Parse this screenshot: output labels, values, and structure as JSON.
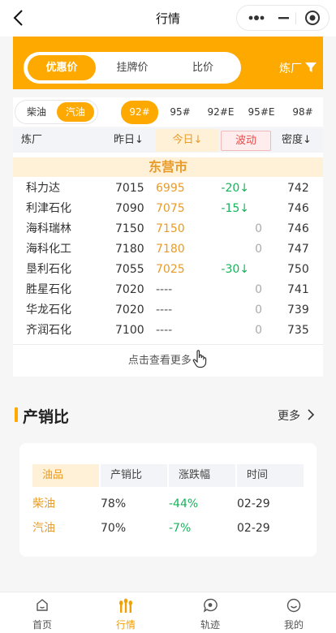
{
  "nav": {
    "title": "行情"
  },
  "header": {
    "tabs": [
      "优惠价",
      "挂牌价",
      "比价"
    ],
    "active_tab": 0,
    "refinery_filter": "炼厂"
  },
  "fuel": {
    "types": [
      "柴油",
      "汽油"
    ],
    "active": 1
  },
  "grades": {
    "items": [
      "92#",
      "95#",
      "92#E",
      "95#E",
      "98#"
    ],
    "active": 0
  },
  "table": {
    "headers": {
      "refinery": "炼厂",
      "yesterday": "昨日",
      "today": "今日",
      "wave": "波动",
      "density": "密度"
    },
    "region": "东营市",
    "rows": [
      {
        "name": "科力达",
        "yesterday": "7015",
        "today": "6995",
        "wave": "-20",
        "density": "742"
      },
      {
        "name": "利津石化",
        "yesterday": "7090",
        "today": "7075",
        "wave": "-15",
        "density": "746"
      },
      {
        "name": "海科瑞林",
        "yesterday": "7150",
        "today": "7150",
        "wave": "0",
        "density": "746"
      },
      {
        "name": "海科化工",
        "yesterday": "7180",
        "today": "7180",
        "wave": "0",
        "density": "747"
      },
      {
        "name": "垦利石化",
        "yesterday": "7055",
        "today": "7025",
        "wave": "-30",
        "density": "750"
      },
      {
        "name": "胜星石化",
        "yesterday": "7020",
        "today": "----",
        "wave": "0",
        "density": "741"
      },
      {
        "name": "华龙石化",
        "yesterday": "7020",
        "today": "----",
        "wave": "0",
        "density": "739"
      },
      {
        "name": "齐润石化",
        "yesterday": "7100",
        "today": "----",
        "wave": "0",
        "density": "735"
      }
    ],
    "more_label": "点击查看更多"
  },
  "ratio_section": {
    "title": "产销比",
    "more": "更多",
    "headers": [
      "油品",
      "产销比",
      "涨跌幅",
      "时间"
    ],
    "rows": [
      {
        "product": "柴油",
        "ratio": "78%",
        "change": "-44%",
        "time": "02-29"
      },
      {
        "product": "汽油",
        "ratio": "70%",
        "change": "-7%",
        "time": "02-29"
      }
    ]
  },
  "tabbar": {
    "items": [
      "首页",
      "行情",
      "轨迹",
      "我的"
    ],
    "active": 1
  },
  "colors": {
    "accent": "#fea900",
    "down": "#17b35a",
    "wave_red": "#e84c4c"
  }
}
